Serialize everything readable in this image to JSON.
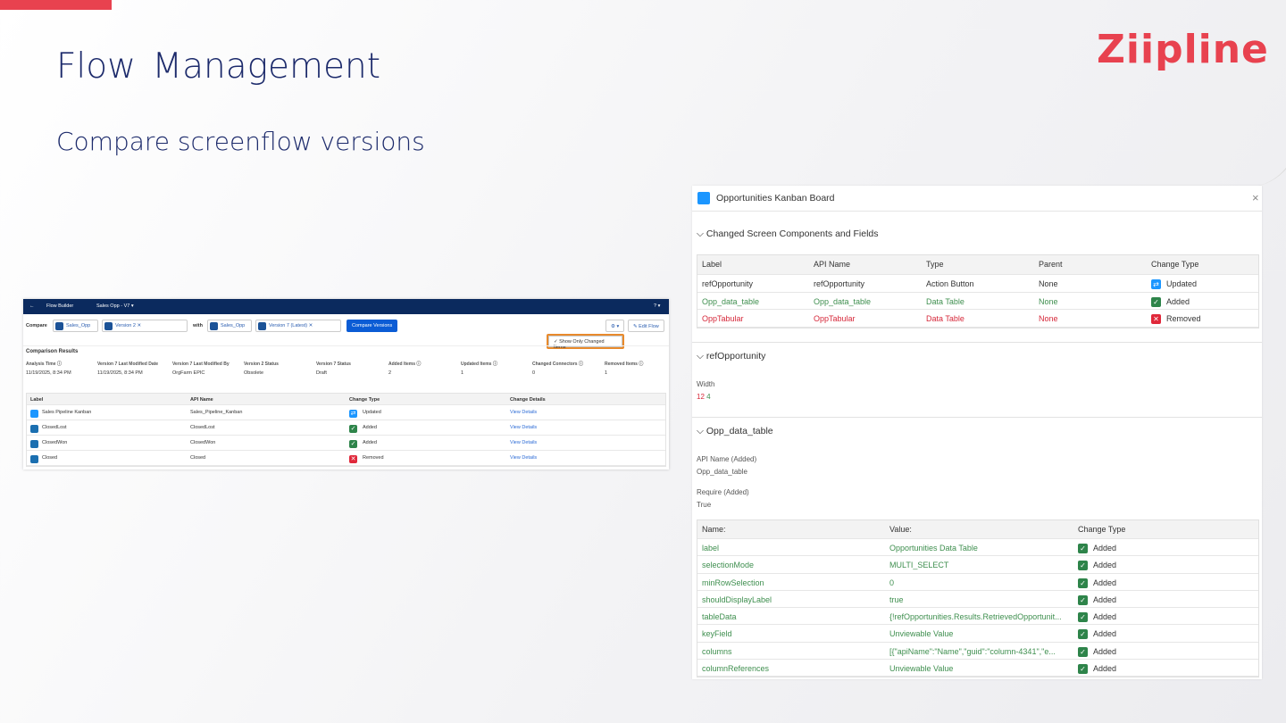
{
  "slide": {
    "title": "Flow  Management",
    "subtitle": "Compare screenflow versions",
    "logo": "Ziipline"
  },
  "left": {
    "header": {
      "back": "←",
      "app": "Flow Builder",
      "flow": "Sales Opp - V7 ▾",
      "help": "? ▾"
    },
    "compare_label": "Compare",
    "with_label": "with",
    "flow1": "Sales_Opp",
    "version1": "Version 2  ✕",
    "flow2": "Sales_Opp",
    "version2": "Version 7 (Latest)  ✕",
    "compare_button": "Compare Versions",
    "gear": "⚙ ▾",
    "edit_button": "✎ Edit Flow",
    "show_changed": "✓  Show Only Changed Items",
    "results_title": "Comparison Results",
    "stats": [
      {
        "k": "Analysis Time ⓘ",
        "v": "11/19/2025, 8:34 PM"
      },
      {
        "k": "Version 7 Last Modified Date",
        "v": "11/19/2025, 8:34 PM"
      },
      {
        "k": "Version 7 Last Modified By",
        "v": "OrgFarm EPIC"
      },
      {
        "k": "Version 2 Status",
        "v": "Obsolete"
      },
      {
        "k": "Version 7 Status",
        "v": "Draft"
      },
      {
        "k": "Added Items ⓘ",
        "v": "2"
      },
      {
        "k": "Updated Items ⓘ",
        "v": "1"
      },
      {
        "k": "Changed Connectors ⓘ",
        "v": "0"
      },
      {
        "k": "Removed Items ⓘ",
        "v": "1"
      }
    ],
    "columns": [
      "Label",
      "API Name",
      "Change Type",
      "Change Details"
    ],
    "rows": [
      {
        "label": "Sales Pipeline Kanban",
        "api": "Sales_Pipeline_Kanban",
        "type": "Updated",
        "details": "View Details"
      },
      {
        "label": "ClosedLost",
        "api": "ClosedLost",
        "type": "Added",
        "details": "View Details"
      },
      {
        "label": "ClosedWon",
        "api": "ClosedWon",
        "type": "Added",
        "details": "View Details"
      },
      {
        "label": "Closed",
        "api": "Closed",
        "type": "Removed",
        "details": "View Details"
      }
    ]
  },
  "right": {
    "title": "Opportunities Kanban Board",
    "close": "×",
    "section1": "Changed Screen Components and Fields",
    "columns": [
      "Label",
      "API Name",
      "Type",
      "Parent",
      "Change Type"
    ],
    "rows": [
      {
        "cells": [
          "refOpportunity",
          "refOpportunity",
          "Action Button",
          "None"
        ],
        "type": "Updated"
      },
      {
        "cells": [
          "Opp_data_table",
          "Opp_data_table",
          "Data Table",
          "None"
        ],
        "type": "Added"
      },
      {
        "cells": [
          "OppTabular",
          "OppTabular",
          "Data Table",
          "None"
        ],
        "type": "Removed"
      }
    ],
    "section2": "refOpportunity",
    "width_label": "Width",
    "width_old": "12",
    "width_new": "4",
    "section3": "Opp_data_table",
    "api_label": "API Name (Added)",
    "api_value": "Opp_data_table",
    "require_label": "Require (Added)",
    "require_value": "True",
    "prop_columns": [
      "Name:",
      "Value:",
      "Change Type"
    ],
    "props": [
      {
        "name": "label",
        "value": "Opportunities Data Table",
        "type": "Added"
      },
      {
        "name": "selectionMode",
        "value": "MULTI_SELECT",
        "type": "Added"
      },
      {
        "name": "minRowSelection",
        "value": "0",
        "type": "Added"
      },
      {
        "name": "shouldDisplayLabel",
        "value": "true",
        "type": "Added"
      },
      {
        "name": "tableData",
        "value": "{!refOpportunities.Results.RetrievedOpportunit...",
        "type": "Added"
      },
      {
        "name": "keyField",
        "value": "Unviewable Value",
        "type": "Added"
      },
      {
        "name": "columns",
        "value": "[{\"apiName\":\"Name\",\"guid\":\"column-4341\",\"e...",
        "type": "Added"
      },
      {
        "name": "columnReferences",
        "value": "Unviewable Value",
        "type": "Added"
      }
    ]
  },
  "colors": {
    "accent": "#e8424f",
    "navy": "#0b2a5e",
    "added": "#2e844a",
    "removed": "#e0283a",
    "updated": "#1b96ff",
    "highlight": "#e88a2c"
  }
}
